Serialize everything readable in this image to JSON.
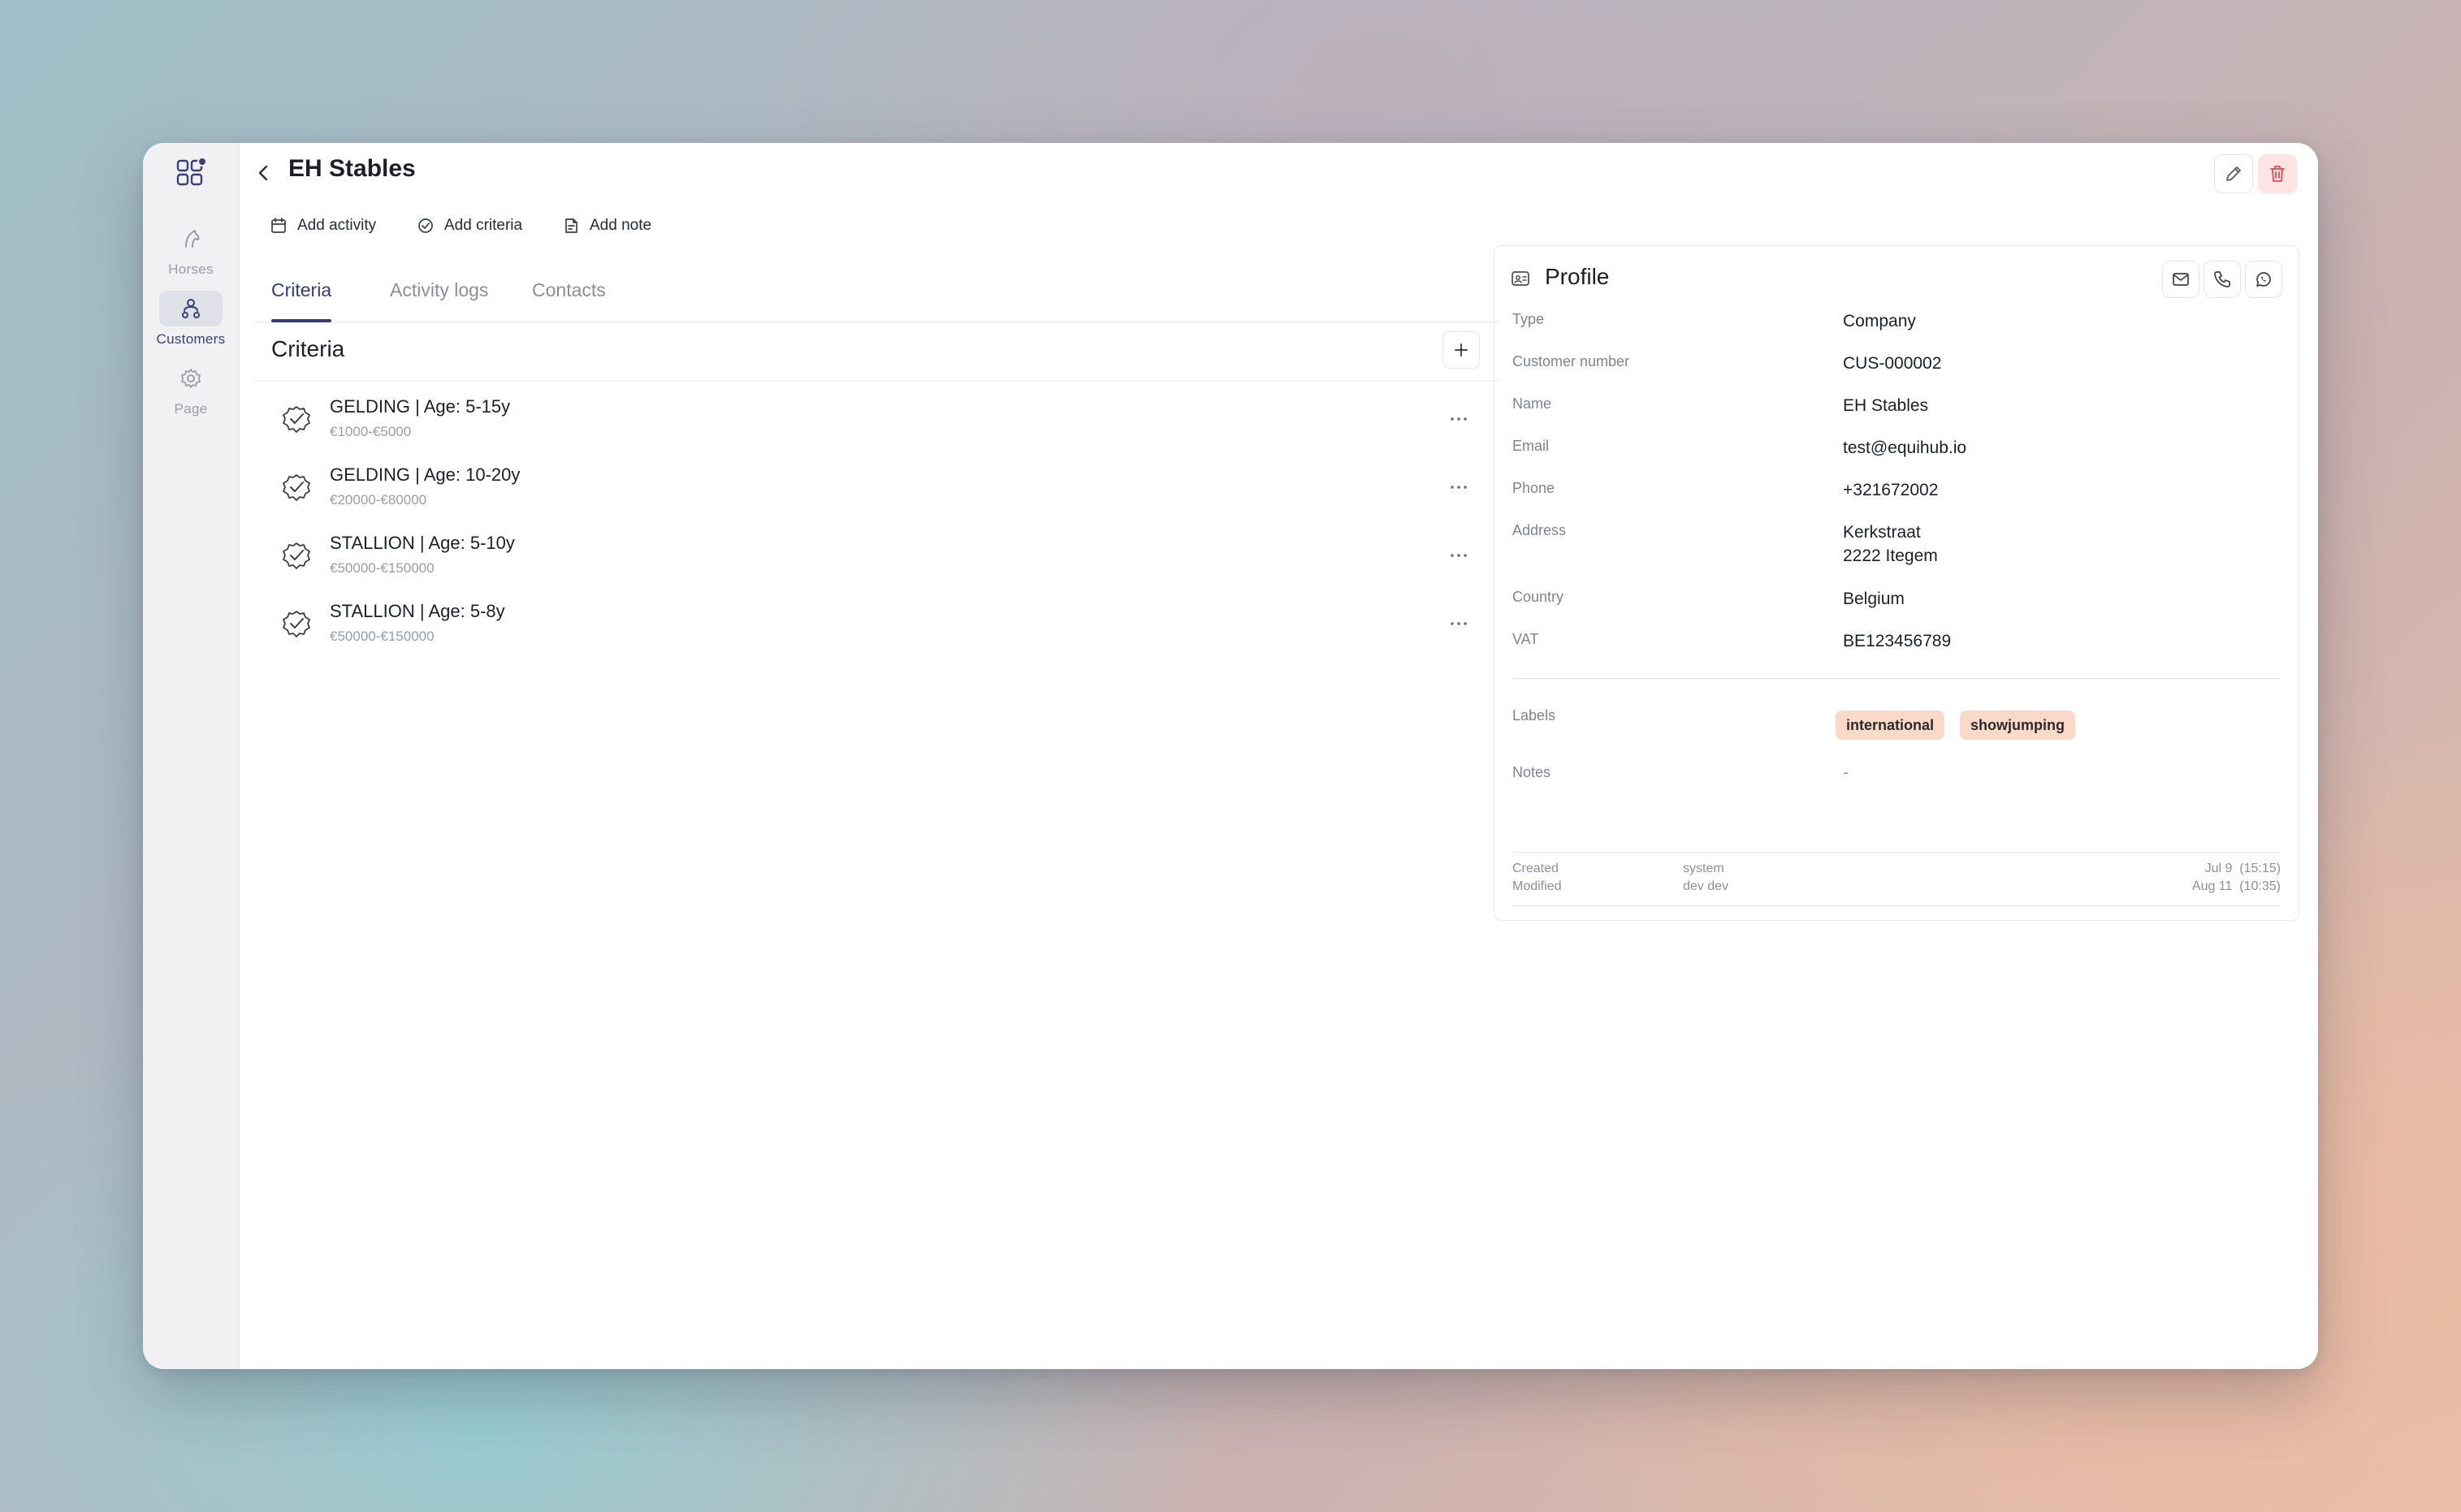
{
  "sidebar": {
    "items": [
      {
        "label": "Horses",
        "icon": "horse-head-icon"
      },
      {
        "label": "Customers",
        "icon": "customers-icon"
      },
      {
        "label": "Page",
        "icon": "gear-icon"
      }
    ],
    "active": "Customers"
  },
  "header": {
    "title": "EH Stables"
  },
  "actions": {
    "add_activity": "Add activity",
    "add_criteria": "Add criteria",
    "add_note": "Add note"
  },
  "tabs": [
    {
      "label": "Criteria",
      "active": true
    },
    {
      "label": "Activity logs",
      "active": false
    },
    {
      "label": "Contacts",
      "active": false
    }
  ],
  "criteria": {
    "title": "Criteria",
    "items": [
      {
        "name": "GELDING | Age: 5-15y",
        "range": "€1000-€5000"
      },
      {
        "name": "GELDING | Age: 10-20y",
        "range": "€20000-€80000"
      },
      {
        "name": "STALLION | Age: 5-10y",
        "range": "€50000-€150000"
      },
      {
        "name": "STALLION | Age: 5-8y",
        "range": "€50000-€150000"
      }
    ]
  },
  "profile": {
    "title": "Profile",
    "fields": {
      "type": {
        "label": "Type",
        "value": "Company"
      },
      "customer_number": {
        "label": "Customer number",
        "value": "CUS-000002"
      },
      "name": {
        "label": "Name",
        "value": "EH Stables"
      },
      "email": {
        "label": "Email",
        "value": "test@equihub.io"
      },
      "phone": {
        "label": "Phone",
        "value": "+321672002"
      },
      "address": {
        "label": "Address",
        "line1": "Kerkstraat",
        "line2": "2222 Itegem"
      },
      "country": {
        "label": "Country",
        "value": "Belgium"
      },
      "vat": {
        "label": "VAT",
        "value": "BE123456789"
      }
    },
    "labels": {
      "label": "Labels",
      "items": [
        "international",
        "showjumping"
      ]
    },
    "notes": {
      "label": "Notes",
      "value": "-"
    },
    "meta": {
      "created_label": "Created",
      "created_by": "system",
      "created_at": "Jul 9  (15:15)",
      "modified_label": "Modified",
      "modified_by": "dev dev",
      "modified_at": "Aug 11  (10:35)"
    }
  },
  "colors": {
    "accent": "#363b7a",
    "danger": "#e5484d",
    "danger_bg": "#fde4e4",
    "badge_bg": "#fbd9c8"
  }
}
